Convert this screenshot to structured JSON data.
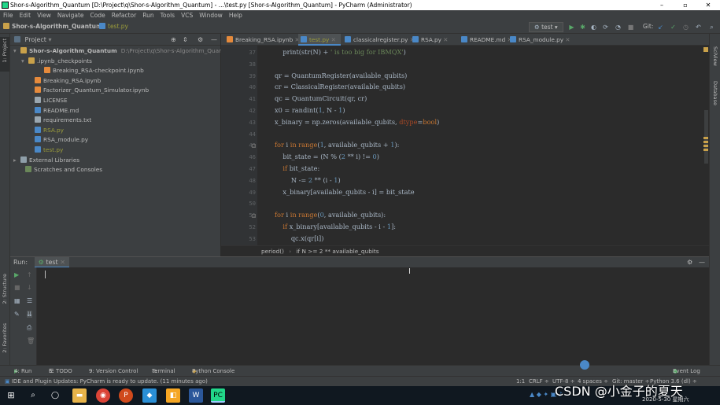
{
  "window": {
    "title": "Shor-s-Algorithm_Quantum [D:\\Project\\q\\Shor-s-Algorithm_Quantum] - ...\\test.py [Shor-s-Algorithm_Quantum] - PyCharm (Administrator)",
    "minimize": "–",
    "maximize": "▫",
    "close": "✕"
  },
  "menu": [
    "File",
    "Edit",
    "View",
    "Navigate",
    "Code",
    "Refactor",
    "Run",
    "Tools",
    "VCS",
    "Window",
    "Help"
  ],
  "nav": {
    "project": "Shor-s-Algorithm_Quantum",
    "file": "test.py",
    "run_config": "test",
    "git_label": "Git:"
  },
  "left_strip": {
    "project_label": "1: Project",
    "structure_label": "2: Structure",
    "favorites_label": "2: Favorites"
  },
  "right_strip": {
    "sciview_label": "SciView",
    "database_label": "Database"
  },
  "project_panel": {
    "title": "Project",
    "rows": [
      {
        "label": "Shor-s-Algorithm_Quantum",
        "extra": "D:\\Project\\q\\Shor-s-Algorithm_Quantum",
        "arrow": "▾",
        "type": "folder",
        "color": "#bbbbbb"
      },
      {
        "label": ".ipynb_checkpoints",
        "extra": "",
        "arrow": "▾",
        "type": "folder",
        "color": "#bbbbbb"
      },
      {
        "label": "Breaking_RSA-checkpoint.ipynb",
        "extra": "",
        "arrow": "",
        "type": "nb",
        "color": "#bbbbbb"
      },
      {
        "label": "Breaking_RSA.ipynb",
        "extra": "",
        "arrow": "",
        "type": "nb",
        "color": "#bbbbbb"
      },
      {
        "label": "Factorizer_Quantum_Simulator.ipynb",
        "extra": "",
        "arrow": "",
        "type": "nb",
        "color": "#bbbbbb"
      },
      {
        "label": "LICENSE",
        "extra": "",
        "arrow": "",
        "type": "txt",
        "color": "#bbbbbb"
      },
      {
        "label": "README.md",
        "extra": "",
        "arrow": "",
        "type": "md",
        "color": "#bbbbbb"
      },
      {
        "label": "requirements.txt",
        "extra": "",
        "arrow": "",
        "type": "txt",
        "color": "#bbbbbb"
      },
      {
        "label": "RSA.py",
        "extra": "",
        "arrow": "",
        "type": "py",
        "color": "#9c9d3b"
      },
      {
        "label": "RSA_module.py",
        "extra": "",
        "arrow": "",
        "type": "py",
        "color": "#bbbbbb"
      },
      {
        "label": "test.py",
        "extra": "",
        "arrow": "",
        "type": "py",
        "color": "#9c9d3b"
      },
      {
        "label": "External Libraries",
        "extra": "",
        "arrow": "▸",
        "type": "lib",
        "color": "#bbbbbb"
      },
      {
        "label": "Scratches and Consoles",
        "extra": "",
        "arrow": "",
        "type": "scratch",
        "color": "#bbbbbb"
      }
    ]
  },
  "tabs": [
    {
      "label": "Breaking_RSA.ipynb",
      "active": false,
      "color": "#bbbbbb"
    },
    {
      "label": "test.py",
      "active": true,
      "color": "#9c9d3b"
    },
    {
      "label": "classicalregister.py",
      "active": false,
      "color": "#bbbbbb"
    },
    {
      "label": "RSA.py",
      "active": false,
      "color": "#bbbbbb"
    },
    {
      "label": "README.md",
      "active": false,
      "color": "#bbbbbb"
    },
    {
      "label": "RSA_module.py",
      "active": false,
      "color": "#bbbbbb"
    }
  ],
  "code": [
    {
      "n": "37",
      "tokens": [
        [
          "    print(str(N) + ",
          "fn"
        ],
        [
          "' is too big for IBMQX'",
          "str"
        ],
        [
          ")",
          "fn"
        ]
      ]
    },
    {
      "n": "38",
      "tokens": []
    },
    {
      "n": "39",
      "tokens": [
        [
          "qr = QuantumRegister(available_qubits)",
          "fn"
        ]
      ]
    },
    {
      "n": "40",
      "tokens": [
        [
          "cr = ClassicalRegister(available_qubits)",
          "fn"
        ]
      ]
    },
    {
      "n": "41",
      "tokens": [
        [
          "qc = QuantumCircuit(qr, cr)",
          "fn"
        ]
      ]
    },
    {
      "n": "42",
      "tokens": [
        [
          "x0 = randint(",
          "fn"
        ],
        [
          "1",
          "num"
        ],
        [
          ", N - ",
          "fn"
        ],
        [
          "1",
          "num"
        ],
        [
          ")",
          "fn"
        ]
      ]
    },
    {
      "n": "43",
      "tokens": [
        [
          "x_binary = np.zeros(available_qubits, ",
          "fn"
        ],
        [
          "dtype",
          "prm"
        ],
        [
          "=",
          "fn"
        ],
        [
          "bool",
          "kw"
        ],
        [
          ")",
          "fn"
        ]
      ]
    },
    {
      "n": "44",
      "tokens": []
    },
    {
      "n": "45",
      "tokens": [
        [
          "for ",
          "kw"
        ],
        [
          "i ",
          "fn"
        ],
        [
          "in ",
          "kw"
        ],
        [
          "range",
          "kw"
        ],
        [
          "(",
          "fn"
        ],
        [
          "1",
          "num"
        ],
        [
          ", available_qubits + ",
          "fn"
        ],
        [
          "1",
          "num"
        ],
        [
          "):",
          "fn"
        ]
      ]
    },
    {
      "n": "46",
      "tokens": [
        [
          "    bit_state = (N % (",
          "fn"
        ],
        [
          "2",
          "num"
        ],
        [
          " ** i) != ",
          "fn"
        ],
        [
          "0",
          "num"
        ],
        [
          ")",
          "fn"
        ]
      ]
    },
    {
      "n": "47",
      "tokens": [
        [
          "    ",
          "fn"
        ],
        [
          "if ",
          "kw"
        ],
        [
          "bit_state:",
          "fn"
        ]
      ]
    },
    {
      "n": "48",
      "tokens": [
        [
          "        N -= ",
          "fn"
        ],
        [
          "2",
          "num"
        ],
        [
          " ** (i - ",
          "fn"
        ],
        [
          "1",
          "num"
        ],
        [
          ")",
          "fn"
        ]
      ]
    },
    {
      "n": "49",
      "tokens": [
        [
          "    x_binary[available_qubits - i] = bit_state",
          "fn"
        ]
      ]
    },
    {
      "n": "50",
      "tokens": []
    },
    {
      "n": "51",
      "tokens": [
        [
          "for ",
          "kw"
        ],
        [
          "i ",
          "fn"
        ],
        [
          "in ",
          "kw"
        ],
        [
          "range",
          "kw"
        ],
        [
          "(",
          "fn"
        ],
        [
          "0",
          "num"
        ],
        [
          ", available_qubits):",
          "fn"
        ]
      ]
    },
    {
      "n": "52",
      "tokens": [
        [
          "    ",
          "fn"
        ],
        [
          "if ",
          "kw"
        ],
        [
          "x_binary[available_qubits - i - ",
          "fn"
        ],
        [
          "1",
          "num"
        ],
        [
          "]:",
          "fn"
        ]
      ]
    },
    {
      "n": "53",
      "tokens": [
        [
          "        qc.x(qr[i])",
          "fn"
        ]
      ]
    }
  ],
  "breadcrumb": {
    "first": "period()",
    "sep": "›",
    "second": "if N >= 2 ** available_qubits"
  },
  "run": {
    "label": "Run:",
    "tab": "test",
    "gear": "⚙",
    "hide": "—"
  },
  "bottom_tabs": [
    "4: Run",
    "6: TODO",
    "9: Version Control",
    "Terminal",
    "Python Console"
  ],
  "event_log": "Event Log",
  "status": {
    "message": "IDE and Plugin Updates: PyCharm is ready to update. (11 minutes ago)",
    "position": "1:1",
    "line_sep": "CRLF ÷",
    "encoding": "UTF-8 ÷",
    "indent": "4 spaces ÷",
    "git": "Git: master ÷",
    "interpreter": "Python 3.6 (dl) ÷"
  },
  "taskbar": {
    "watermark": "CSDN @小金子的夏天",
    "date": "2020-5-30 星期六"
  },
  "colors": {
    "accent": "#4a88c7",
    "keyword": "#cc7832",
    "number": "#6897bb",
    "string": "#6a8759",
    "param": "#aa4926",
    "modified_file": "#9c9d3b"
  }
}
